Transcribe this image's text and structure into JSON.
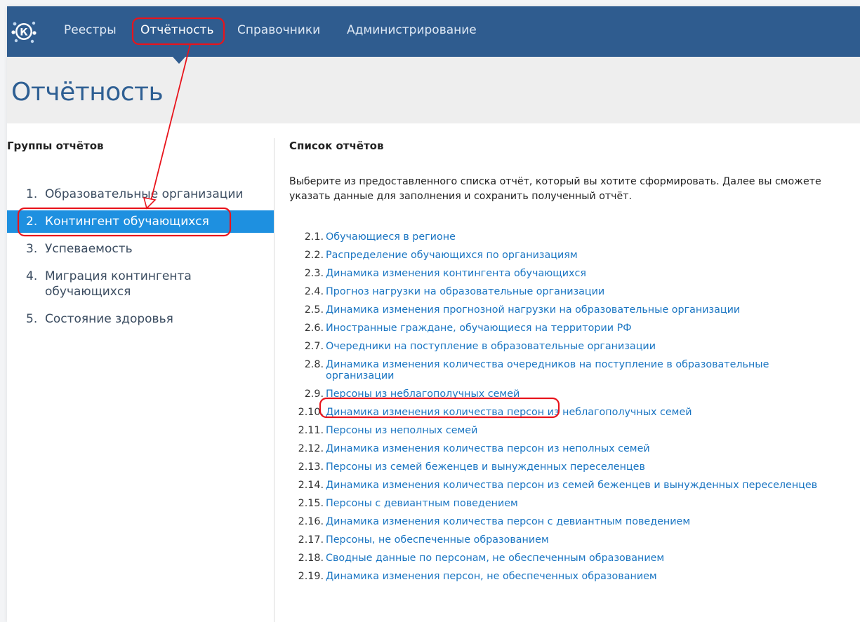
{
  "nav": {
    "items": [
      {
        "label": "Реестры"
      },
      {
        "label": "Отчётность"
      },
      {
        "label": "Справочники"
      },
      {
        "label": "Администрирование"
      }
    ],
    "logo_letter": "К"
  },
  "page": {
    "title": "Отчётность"
  },
  "left": {
    "heading": "Группы отчётов",
    "groups": [
      {
        "num": "1.",
        "label": "Образовательные организации"
      },
      {
        "num": "2.",
        "label": "Контингент обучающихся"
      },
      {
        "num": "3.",
        "label": "Успеваемость"
      },
      {
        "num": "4.",
        "label": "Миграция контингента обучающихся"
      },
      {
        "num": "5.",
        "label": "Состояние здоровья"
      }
    ],
    "selected_index": 1
  },
  "right": {
    "heading": "Список отчётов",
    "intro_line1": "Выберите из предоставленного списка отчёт, который вы хотите сформировать. Далее вы сможете",
    "intro_line2": "указать данные для заполнения и сохранить полученный отчёт.",
    "reports": [
      {
        "num": "2.1.",
        "label": "Обучающиеся в регионе"
      },
      {
        "num": "2.2.",
        "label": "Распределение обучающихся по организациям"
      },
      {
        "num": "2.3.",
        "label": "Динамика изменения контингента обучающихся"
      },
      {
        "num": "2.4.",
        "label": "Прогноз нагрузки на образовательные организации"
      },
      {
        "num": "2.5.",
        "label": "Динамика изменения прогнозной нагрузки на образовательные организации"
      },
      {
        "num": "2.6.",
        "label": "Иностранные граждане, обучающиеся на территории РФ"
      },
      {
        "num": "2.7.",
        "label": "Очередники на поступление в образовательные организации"
      },
      {
        "num": "2.8.",
        "label": "Динамика изменения количества очередников на поступление в образовательные организации"
      },
      {
        "num": "2.9.",
        "label": "Персоны из неблагополучных семей"
      },
      {
        "num": "2.10.",
        "label": "Динамика изменения количества персон из неблагополучных семей"
      },
      {
        "num": "2.11.",
        "label": "Персоны из неполных семей"
      },
      {
        "num": "2.12.",
        "label": "Динамика изменения количества персон из неполных семей"
      },
      {
        "num": "2.13.",
        "label": "Персоны из семей беженцев и вынужденных переселенцев"
      },
      {
        "num": "2.14.",
        "label": "Динамика изменения количества персон из семей беженцев и вынужденных переселенцев"
      },
      {
        "num": "2.15.",
        "label": "Персоны с девиантным поведением"
      },
      {
        "num": "2.16.",
        "label": "Динамика изменения количества персон с девиантным поведением"
      },
      {
        "num": "2.17.",
        "label": "Персоны, не обеспеченные образованием"
      },
      {
        "num": "2.18.",
        "label": "Сводные данные по персонам, не обеспеченным образованием"
      },
      {
        "num": "2.19.",
        "label": "Динамика изменения персон, не обеспеченных образованием"
      }
    ]
  },
  "colors": {
    "nav_bg": "#2f5c8f",
    "title_color": "#2e5f93",
    "selected_bg": "#1e90e0",
    "link": "#1a75c2",
    "annotation": "#e8141c"
  }
}
